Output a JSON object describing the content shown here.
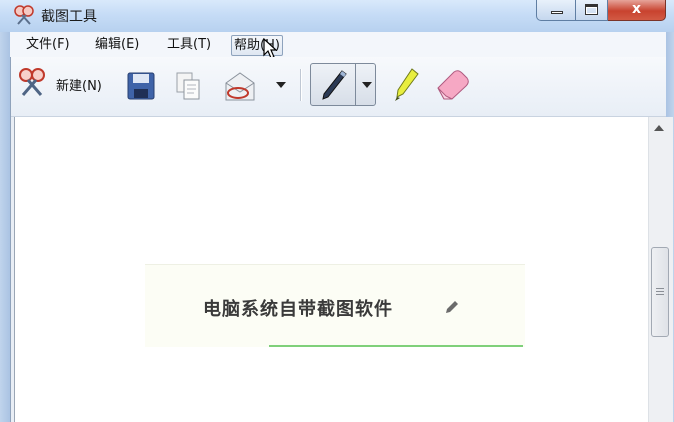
{
  "window": {
    "title": "截图工具",
    "controls": {
      "close_label": "x"
    }
  },
  "menu": {
    "items": [
      "文件(F)",
      "编辑(E)",
      "工具(T)",
      "帮助(H)"
    ],
    "active_index": 3
  },
  "toolbar": {
    "new_label": "新建(N)",
    "icons": [
      "scissors-icon",
      "save-icon",
      "copy-icon",
      "send-email-icon",
      "pen-icon",
      "highlighter-icon",
      "eraser-icon"
    ]
  },
  "content": {
    "card_title": "电脑系统自带截图软件",
    "card_icon": "edit-pencil-icon"
  },
  "colors": {
    "title_gradient_top": "#d9e9fb",
    "close_red": "#c8432f",
    "card_bg": "#fcfdf5",
    "green_line": "#7fd07a"
  }
}
